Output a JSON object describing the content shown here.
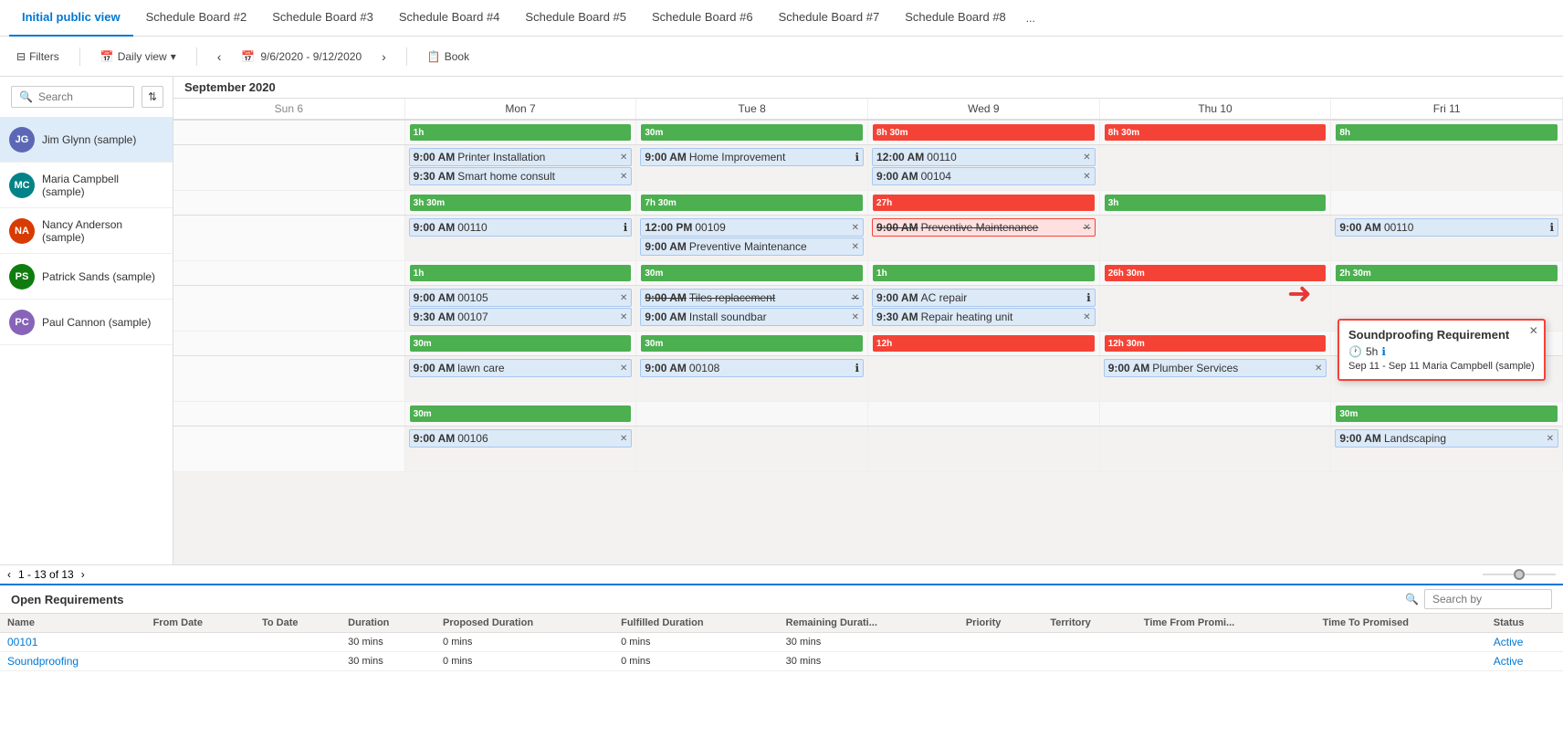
{
  "tabs": [
    {
      "label": "Initial public view",
      "active": true
    },
    {
      "label": "Schedule Board #2"
    },
    {
      "label": "Schedule Board #3"
    },
    {
      "label": "Schedule Board #4"
    },
    {
      "label": "Schedule Board #5"
    },
    {
      "label": "Schedule Board #6"
    },
    {
      "label": "Schedule Board #7"
    },
    {
      "label": "Schedule Board #8"
    },
    {
      "label": "..."
    }
  ],
  "toolbar": {
    "filters_label": "Filters",
    "view_label": "Daily view",
    "date_range": "9/6/2020 - 9/12/2020",
    "book_label": "Book"
  },
  "sidebar": {
    "search_placeholder": "Search",
    "resources": [
      {
        "initials": "JG",
        "name": "Jim Glynn (sample)",
        "color": "#5c68b5",
        "selected": true
      },
      {
        "initials": "MC",
        "name": "Maria Campbell (sample)",
        "color": "#038387"
      },
      {
        "initials": "NA",
        "name": "Nancy Anderson (sample)",
        "color": "#d83b01"
      },
      {
        "initials": "PS",
        "name": "Patrick Sands (sample)",
        "color": "#107c10"
      },
      {
        "initials": "PC",
        "name": "Paul Cannon (sample)",
        "color": "#8764b8"
      }
    ]
  },
  "calendar": {
    "month": "September 2020",
    "days": [
      {
        "label": "Sun 6",
        "weekend": true
      },
      {
        "label": "Mon 7",
        "weekend": false
      },
      {
        "label": "Tue 8",
        "weekend": false
      },
      {
        "label": "Wed 9",
        "weekend": false
      },
      {
        "label": "Thu 10",
        "weekend": false
      },
      {
        "label": "Fri 11",
        "weekend": false
      }
    ]
  },
  "rows": [
    {
      "resource": "Jim Glynn",
      "summary": [
        "",
        "1h",
        "30m",
        "8h 30m",
        "8h 30m",
        "8h"
      ],
      "summary_colors": [
        "",
        "green",
        "green",
        "red",
        "red",
        "green"
      ],
      "events": [
        [],
        [
          {
            "time": "9:00 AM",
            "title": "Printer Installation",
            "has_close": true
          },
          {
            "time": "9:30 AM",
            "title": "Smart home consult",
            "has_close": true
          }
        ],
        [
          {
            "time": "9:00 AM",
            "title": "Home Improvement",
            "has_close": false
          }
        ],
        [
          {
            "time": "12:00 AM",
            "title": "00110",
            "has_close": true
          },
          {
            "time": "9:00 AM",
            "title": "00104",
            "has_close": true
          }
        ],
        [],
        []
      ]
    },
    {
      "resource": "Maria Campbell",
      "summary": [
        "",
        "3h 30m",
        "7h 30m",
        "27h",
        "3h",
        ""
      ],
      "summary_colors": [
        "",
        "green",
        "green",
        "red",
        "green",
        ""
      ],
      "events": [
        [],
        [
          {
            "time": "9:00 AM",
            "title": "00110",
            "has_close": false
          }
        ],
        [
          {
            "time": "12:00 PM",
            "title": "00109",
            "has_close": true
          },
          {
            "time": "9:00 AM",
            "title": "Preventive Maintenance",
            "has_close": true
          }
        ],
        [
          {
            "time": "9:00 AM",
            "title": "Preventive Maintenance",
            "has_close": true,
            "strikethrough": true,
            "highlight": true
          }
        ],
        [],
        [
          {
            "time": "9:00 AM",
            "title": "00110",
            "has_close": false,
            "is_popup_trigger": true
          }
        ]
      ]
    },
    {
      "resource": "Nancy Anderson",
      "summary": [
        "",
        "1h",
        "30m",
        "1h",
        "26h 30m",
        "2h 30m"
      ],
      "summary_colors": [
        "",
        "green",
        "green",
        "green",
        "red",
        "green"
      ],
      "events": [
        [],
        [
          {
            "time": "9:00 AM",
            "title": "00105",
            "has_close": true
          },
          {
            "time": "9:30 AM",
            "title": "00107",
            "has_close": true
          }
        ],
        [
          {
            "time": "9:00 AM",
            "title": "Tiles replacement",
            "has_close": true,
            "strikethrough": true
          },
          {
            "time": "9:00 AM",
            "title": "Install soundbar",
            "has_close": true
          }
        ],
        [
          {
            "time": "9:00 AM",
            "title": "AC repair",
            "has_close": false
          },
          {
            "time": "9:30 AM",
            "title": "Repair heating unit",
            "has_close": true
          }
        ],
        [],
        []
      ]
    },
    {
      "resource": "Patrick Sands",
      "summary": [
        "",
        "30m",
        "30m",
        "12h",
        "12h 30m",
        ""
      ],
      "summary_colors": [
        "",
        "green",
        "green",
        "red",
        "red",
        ""
      ],
      "events": [
        [],
        [
          {
            "time": "9:00 AM",
            "title": "lawn care",
            "has_close": true
          }
        ],
        [
          {
            "time": "9:00 AM",
            "title": "00108",
            "has_close": false
          }
        ],
        [],
        [
          {
            "time": "9:00 AM",
            "title": "Plumber Services",
            "has_close": true
          }
        ],
        []
      ]
    },
    {
      "resource": "Paul Cannon",
      "summary": [
        "",
        "30m",
        "",
        "",
        "",
        "30m"
      ],
      "summary_colors": [
        "",
        "green",
        "",
        "",
        "",
        "green"
      ],
      "events": [
        [],
        [
          {
            "time": "9:00 AM",
            "title": "00106",
            "has_close": true
          }
        ],
        [],
        [],
        [],
        [
          {
            "time": "9:00 AM",
            "title": "Landscaping",
            "has_close": true
          }
        ]
      ]
    }
  ],
  "popup": {
    "title": "Soundproofing Requirement",
    "duration": "5h",
    "person": "Sep 11 - Sep 11 Maria Campbell (sample)"
  },
  "pagination": {
    "text": "1 - 13 of 13"
  },
  "bottom_panel": {
    "title": "Open Requirements",
    "search_placeholder": "Search by",
    "columns": [
      "Name",
      "From Date",
      "To Date",
      "Duration",
      "Proposed Duration",
      "Fulfilled Duration",
      "Remaining Durati...",
      "Priority",
      "Territory",
      "Time From Promi...",
      "Time To Promised",
      "Status"
    ],
    "rows": [
      {
        "name": "00101",
        "from_date": "",
        "to_date": "",
        "duration": "30 mins",
        "proposed": "0 mins",
        "fulfilled": "0 mins",
        "remaining": "30 mins",
        "priority": "",
        "territory": "",
        "time_from": "",
        "time_to": "",
        "status": "Active"
      },
      {
        "name": "Soundproofing",
        "from_date": "",
        "to_date": "",
        "duration": "30 mins",
        "proposed": "0 mins",
        "fulfilled": "0 mins",
        "remaining": "30 mins",
        "priority": "",
        "territory": "",
        "time_from": "",
        "time_to": "",
        "status": "Active"
      }
    ]
  }
}
